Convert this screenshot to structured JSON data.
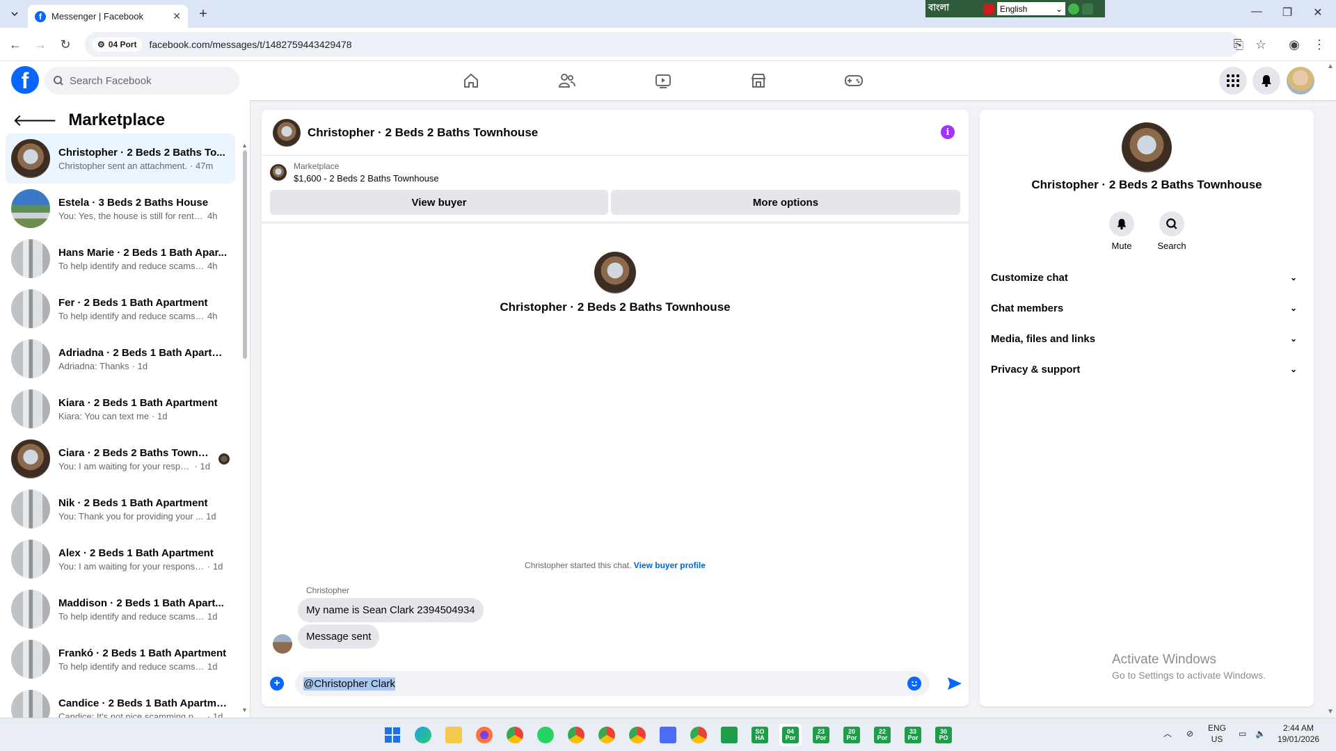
{
  "browser": {
    "tab_title": "Messenger | Facebook",
    "site_chip": "04 Port",
    "url": "facebook.com/messages/t/1482759443429478",
    "ime_label": "বাংলা",
    "ime_language": "English"
  },
  "header": {
    "search_placeholder": "Search Facebook"
  },
  "sidebar": {
    "title": "Marketplace",
    "conversations": [
      {
        "name": "Christopher · 2 Beds 2 Baths To...",
        "msg": "Christopher sent an attachment.",
        "time": "· 47m",
        "avatar": "room",
        "active": true
      },
      {
        "name": "Estela · 3 Beds 2 Baths House",
        "msg": "You: Yes, the house is still for rent. ...",
        "time": "4h",
        "avatar": "house"
      },
      {
        "name": "Hans Marie · 2 Beds 1 Bath Apar...",
        "msg": "To help identify and reduce scams ...",
        "time": "4h",
        "avatar": "gray"
      },
      {
        "name": "Fer · 2 Beds 1 Bath Apartment",
        "msg": "To help identify and reduce scams ...",
        "time": "4h",
        "avatar": "gray"
      },
      {
        "name": "Adriadna · 2 Beds 1 Bath Apartm...",
        "msg": "Adriadna: Thanks",
        "time": "· 1d",
        "avatar": "gray"
      },
      {
        "name": "Kiara · 2 Beds 1 Bath Apartment",
        "msg": "Kiara: You can text me",
        "time": "· 1d",
        "avatar": "gray"
      },
      {
        "name": "Ciara · 2 Beds 2 Baths Townho...",
        "msg": "You: I am waiting for your respo...",
        "time": "· 1d",
        "avatar": "room",
        "seen": true
      },
      {
        "name": "Nik · 2 Beds 1 Bath Apartment",
        "msg": "You: Thank you for providing your ...",
        "time": "1d",
        "avatar": "gray"
      },
      {
        "name": "Alex · 2 Beds 1 Bath Apartment",
        "msg": "You: I am waiting for your response...",
        "time": "· 1d",
        "avatar": "gray"
      },
      {
        "name": "Maddison · 2 Beds 1 Bath Apart...",
        "msg": "To help identify and reduce scams ...",
        "time": "1d",
        "avatar": "gray"
      },
      {
        "name": "Frankó · 2 Beds 1 Bath Apartment",
        "msg": "To help identify and reduce scams ...",
        "time": "1d",
        "avatar": "gray"
      },
      {
        "name": "Candice · 2 Beds 1 Bath Apartme...",
        "msg": "Candice: It's not nice scamming pe...",
        "time": "· 1d",
        "avatar": "gray"
      }
    ]
  },
  "chat": {
    "title": "Christopher · 2 Beds 2 Baths Townhouse",
    "listing_label": "Marketplace",
    "listing_price": "$1,600 - 2 Beds 2 Baths Townhouse",
    "view_buyer": "View buyer",
    "more_options": "More options",
    "profile_name": "Christopher · 2 Beds 2 Baths Townhouse",
    "started_text": "Christopher started this chat.",
    "view_buyer_profile": "View buyer profile",
    "sender_name": "Christopher",
    "messages": [
      "My name is Sean Clark 2394504934",
      "Message sent"
    ],
    "composer_value": "@Christopher Clark"
  },
  "details": {
    "name": "Christopher · 2 Beds 2 Baths Townhouse",
    "mute_label": "Mute",
    "search_label": "Search",
    "rows": [
      "Customize chat",
      "Chat members",
      "Media, files and links",
      "Privacy & support"
    ]
  },
  "watermark": {
    "line1": "Activate Windows",
    "line2": "Go to Settings to activate Windows."
  },
  "taskbar": {
    "apps": [
      {
        "label": "SO HA",
        "color": "#2e9e55"
      },
      {
        "label": "04 Por",
        "color": "#1f9d4a"
      },
      {
        "label": "23 Por",
        "color": "#1f9d4a"
      },
      {
        "label": "20 Por",
        "color": "#1f9d4a"
      },
      {
        "label": "22 Por",
        "color": "#1f9d4a"
      },
      {
        "label": "33 Por",
        "color": "#1f9d4a"
      },
      {
        "label": "30 PO",
        "color": "#1f9d4a"
      }
    ],
    "lang_line1": "ENG",
    "lang_line2": "US",
    "time": "2:44 AM",
    "date": "19/01/2026"
  }
}
